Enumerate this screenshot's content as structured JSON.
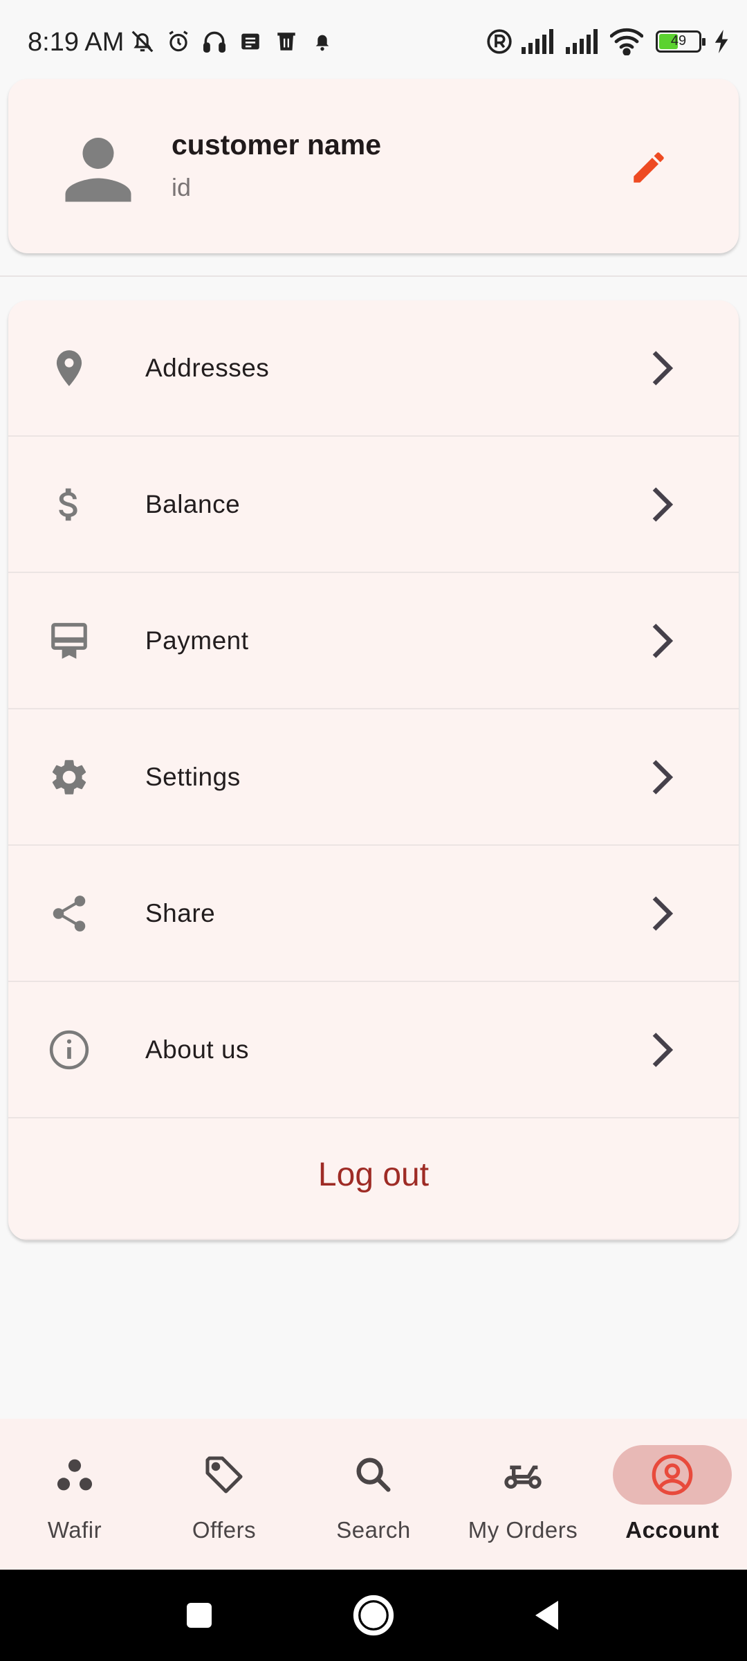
{
  "status_bar": {
    "time": "8:19 AM",
    "left_icons": [
      "bell-off-icon",
      "alarm-icon",
      "headphones-icon",
      "message-icon",
      "trash-icon",
      "notification-bell-icon"
    ],
    "right_icons": [
      "registered-icon",
      "signal-icon",
      "signal-icon",
      "wifi-icon",
      "battery-icon",
      "charging-icon"
    ],
    "battery_level": "49"
  },
  "profile": {
    "name": "customer name",
    "id": "id",
    "avatar_icon": "person-icon",
    "edit_icon": "pencil-icon",
    "edit_color": "#ee4a22"
  },
  "menu": {
    "items": [
      {
        "label": "Addresses",
        "icon": "location-pin-icon"
      },
      {
        "label": "Balance",
        "icon": "dollar-icon"
      },
      {
        "label": "Payment",
        "icon": "payment-card-icon"
      },
      {
        "label": "Settings",
        "icon": "gear-icon"
      },
      {
        "label": "Share",
        "icon": "share-icon"
      },
      {
        "label": "About us",
        "icon": "info-icon"
      }
    ],
    "logout_label": "Log out",
    "logout_color": "#9e2b25"
  },
  "bottom_nav": {
    "items": [
      {
        "label": "Wafir",
        "icon": "dots-cluster-icon",
        "active": false
      },
      {
        "label": "Offers",
        "icon": "tag-icon",
        "active": false
      },
      {
        "label": "Search",
        "icon": "search-icon",
        "active": false
      },
      {
        "label": "My Orders",
        "icon": "scooter-icon",
        "active": false
      },
      {
        "label": "Account",
        "icon": "account-circle-icon",
        "active": true
      }
    ],
    "active_pill_color": "#e8b9b6",
    "active_icon_color": "#e84a3c"
  },
  "system_nav": {
    "buttons": [
      "recents-icon",
      "home-icon",
      "back-icon"
    ]
  }
}
